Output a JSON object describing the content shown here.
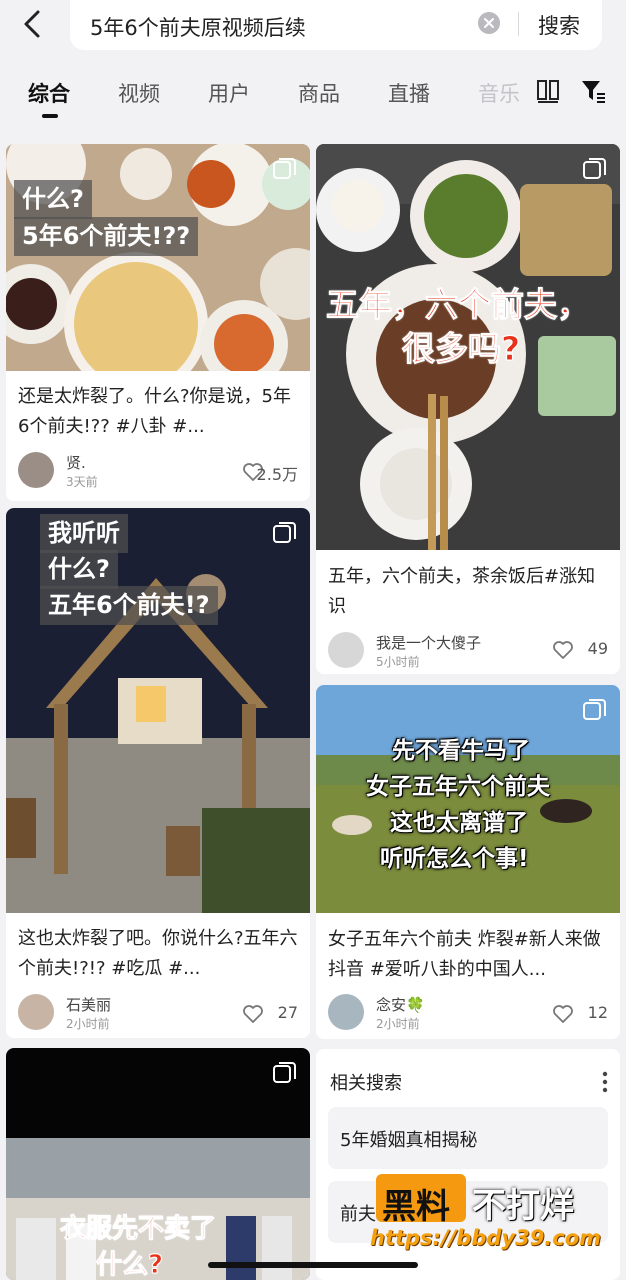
{
  "search": {
    "query": "5年6个前夫原视频后续",
    "button_label": "搜索"
  },
  "tabs": [
    {
      "label": "综合",
      "active": true
    },
    {
      "label": "视频",
      "active": false
    },
    {
      "label": "用户",
      "active": false
    },
    {
      "label": "商品",
      "active": false
    },
    {
      "label": "直播",
      "active": false
    },
    {
      "label": "音乐",
      "active": false
    }
  ],
  "cards": [
    {
      "overlay_lines": [
        "什么?",
        "5年6个前夫!??"
      ],
      "caption": "还是太炸裂了。什么?你是说，5年6个前夫!?? #八卦 #...",
      "author": "贤.",
      "time": "3天前",
      "likes": "2.5万"
    },
    {
      "overlay_lines": [
        "五年，六个前夫，",
        "很多吗?"
      ],
      "caption": "五年，六个前夫，茶余饭后#涨知识",
      "author": "我是一个大傻子",
      "time": "5小时前",
      "likes": "49"
    },
    {
      "overlay_lines": [
        "我听听",
        "什么?",
        "五年6个前夫!?"
      ],
      "caption": "这也太炸裂了吧。你说什么?五年六个前夫!?!? #吃瓜 #...",
      "author": "石美丽",
      "time": "2小时前",
      "likes": "27"
    },
    {
      "overlay_lines": [
        "先不看牛马了",
        "女子五年六个前夫",
        "这也太离谱了",
        "听听怎么个事!"
      ],
      "caption": "女子五年六个前夫 炸裂#新人来做抖音 #爱听八卦的中国人...",
      "author": "念安🍀",
      "time": "2小时前",
      "likes": "12"
    },
    {
      "overlay_lines": [
        "衣服先不卖了",
        "什么?"
      ]
    }
  ],
  "related": {
    "title": "相关搜索",
    "items": [
      "5年婚姻真相揭秘",
      "前夫"
    ]
  },
  "watermark": {
    "left": "黑料",
    "right": "不打烊",
    "url": "https://bbdy39.com"
  },
  "icons": {
    "back": "chevron-left-icon",
    "clear": "clear-icon",
    "grid": "grid-icon",
    "filter": "filter-icon",
    "heart": "heart-icon",
    "multi": "multi-image-icon",
    "more": "more-vertical-icon"
  }
}
